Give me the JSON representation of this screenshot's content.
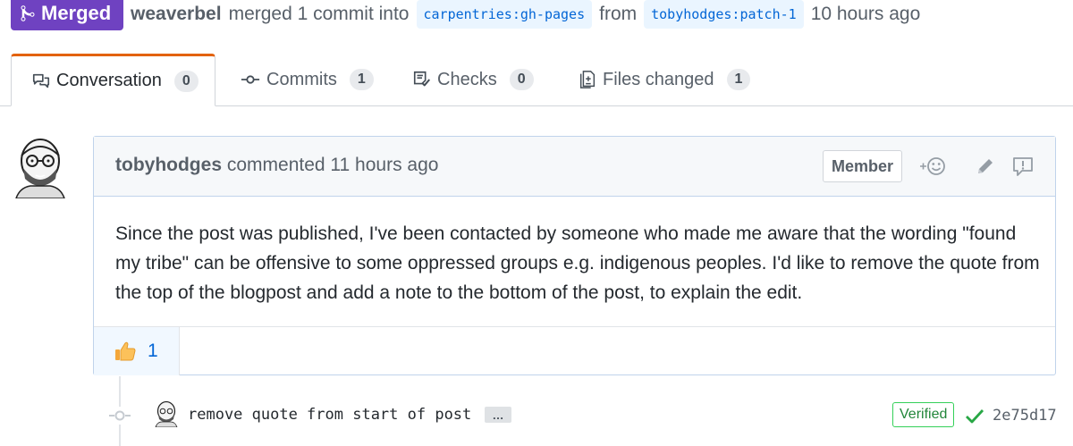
{
  "header": {
    "state_label": "Merged",
    "merger": "weaverbel",
    "merged_text": "merged 1 commit into",
    "base_branch": "carpentries:gh-pages",
    "from_text": "from",
    "head_branch": "tobyhodges:patch-1",
    "time": "10 hours ago"
  },
  "tabs": [
    {
      "label": "Conversation",
      "count": "0",
      "icon": "comment-discussion-icon",
      "selected": true
    },
    {
      "label": "Commits",
      "count": "1",
      "icon": "git-commit-icon"
    },
    {
      "label": "Checks",
      "count": "0",
      "icon": "checklist-icon"
    },
    {
      "label": "Files changed",
      "count": "1",
      "icon": "diff-icon"
    }
  ],
  "comment": {
    "author": "tobyhodges",
    "action": "commented",
    "time": "11 hours ago",
    "role_badge": "Member",
    "body": "Since the post was published, I've been contacted by someone who made me aware that the wording \"found my tribe\" can be offensive to some oppressed groups e.g. indigenous peoples. I'd like to remove the quote from the top of the blogpost and add a note to the bottom of the post, to explain the edit.",
    "reaction_count": "1",
    "header_icons": [
      "add-reaction-icon",
      "pencil-icon",
      "report-icon"
    ]
  },
  "commit": {
    "message": "remove quote from start of post",
    "ellipsis": "…",
    "verified_label": "Verified",
    "sha": "2e75d17"
  },
  "colors": {
    "merged_purple": "#6f42c1",
    "tab_accent": "#e36209",
    "link_blue": "#0366d6",
    "verified_green": "#22863a"
  }
}
